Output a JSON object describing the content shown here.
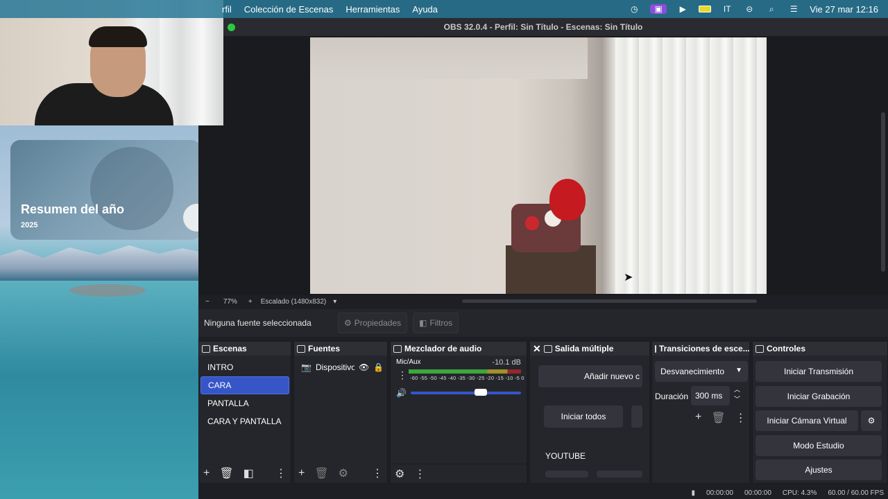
{
  "menubar": {
    "partial_menu": "rfil",
    "menus": [
      "Colección de Escenas",
      "Herramientas",
      "Ayuda"
    ],
    "clock": "Vie 27 mar 12:16"
  },
  "desktop": {
    "card_title": "Resumen del año",
    "card_year": "2025"
  },
  "window": {
    "title": "OBS 32.0.4 - Perfil: Sin Título - Escenas: Sin Título"
  },
  "zoombar": {
    "minus": "−",
    "zoom": "77%",
    "plus": "+",
    "scale": "Escalado (1480x832)",
    "caret": "▾"
  },
  "sourcebar": {
    "no_source": "Ninguna fuente seleccionada",
    "properties": "Propiedades",
    "filters": "Filtros"
  },
  "scenes": {
    "title": "Escenas",
    "items": [
      "INTRO",
      "CARA",
      "PANTALLA",
      "CARA Y PANTALLA"
    ],
    "selected": "CARA"
  },
  "sources": {
    "title": "Fuentes",
    "items": [
      "Dispositivo"
    ]
  },
  "mixer": {
    "title": "Mezclador de audio",
    "channel": "Mic/Aux",
    "db": "-10.1 dB",
    "ticks": "-60 -55 -50 -45 -40 -35 -30 -25 -20 -15 -10 -5  0"
  },
  "multi_output": {
    "title": "Salida múltiple",
    "add_button": "Añadir nuevo c",
    "start_all": "Iniciar todos",
    "target": "YOUTUBE"
  },
  "transitions": {
    "title": "Transiciones de esce...",
    "selected": "Desvanecimiento",
    "duration_label": "Duración",
    "duration_value": "300 ms"
  },
  "controls": {
    "title": "Controles",
    "buttons": [
      "Iniciar Transmisión",
      "Iniciar Grabación",
      "Iniciar Cámara Virtual",
      "Modo Estudio",
      "Ajustes"
    ]
  },
  "status": {
    "stream_time": "00:00:00",
    "rec_time": "00:00:00",
    "cpu": "CPU: 4.3%",
    "fps": "60.00 / 60.00 FPS"
  }
}
